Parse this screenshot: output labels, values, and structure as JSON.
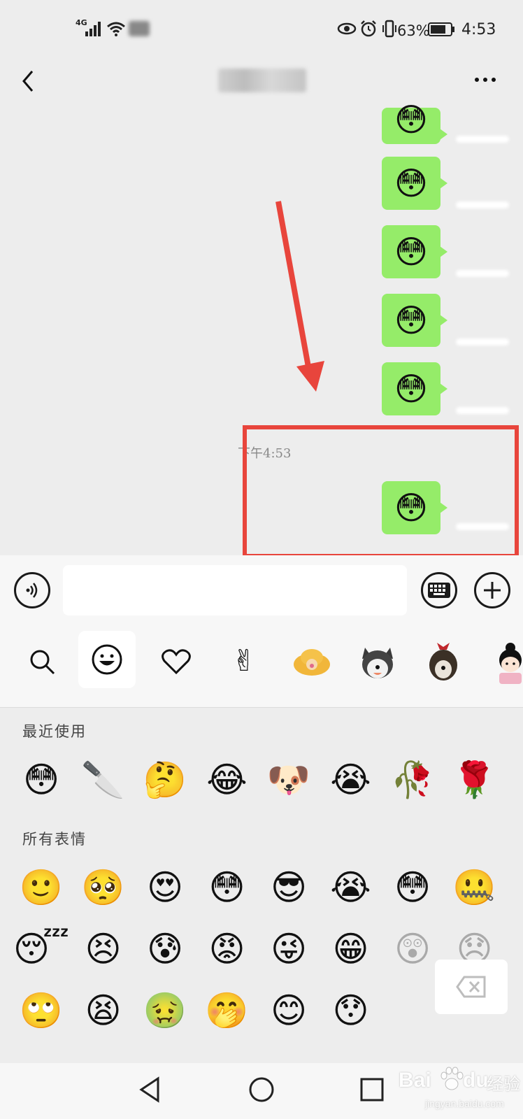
{
  "status_bar": {
    "network": "4G",
    "battery_pct": "63%",
    "time": "4:53"
  },
  "header": {
    "back_icon": "chevron-left-icon",
    "more_icon": "ellipsis-icon"
  },
  "chat": {
    "messages_emoji": "😳",
    "timestamp": "下午4:53"
  },
  "annotation": {
    "arrow_color": "#e8453c",
    "box_color": "#e8453c"
  },
  "input_bar": {
    "voice_icon": "voice-icon",
    "keyboard_icon": "keyboard-icon",
    "plus_icon": "plus-icon"
  },
  "tabs": [
    {
      "icon": "search-icon"
    },
    {
      "icon": "smiley-icon",
      "selected": true
    },
    {
      "icon": "heart-icon"
    },
    {
      "icon": "victory-hand-icon"
    },
    {
      "icon": "hat-sticker-icon"
    },
    {
      "icon": "dog-sticker-icon"
    },
    {
      "icon": "dog-bow-sticker-icon"
    },
    {
      "icon": "girl-sticker-icon"
    }
  ],
  "panel": {
    "recent_label": "最近使用",
    "all_label": "所有表情",
    "recent": [
      "😳",
      "🔪",
      "🤔",
      "😂",
      "🐶",
      "😭",
      "🥀",
      "🌹"
    ],
    "all_rows": [
      [
        "🙂",
        "🥺",
        "😍",
        "😳",
        "😎",
        "😭",
        "😳",
        "🤐"
      ],
      [
        "😴",
        "😣",
        "😰",
        "😡",
        "😜",
        "😁",
        "😲",
        "😞"
      ],
      [
        "🙄",
        "😫",
        "🤢",
        "🤭",
        "😊",
        "😯"
      ]
    ],
    "delete_icon": "backspace-icon"
  },
  "nav": {
    "back_icon": "triangle-back-icon",
    "home_icon": "circle-home-icon",
    "recents_icon": "square-recents-icon"
  },
  "watermark": {
    "text_a": "Bai",
    "text_b": "du",
    "text_c": "经验",
    "url": "jingyan.baidu.com"
  }
}
